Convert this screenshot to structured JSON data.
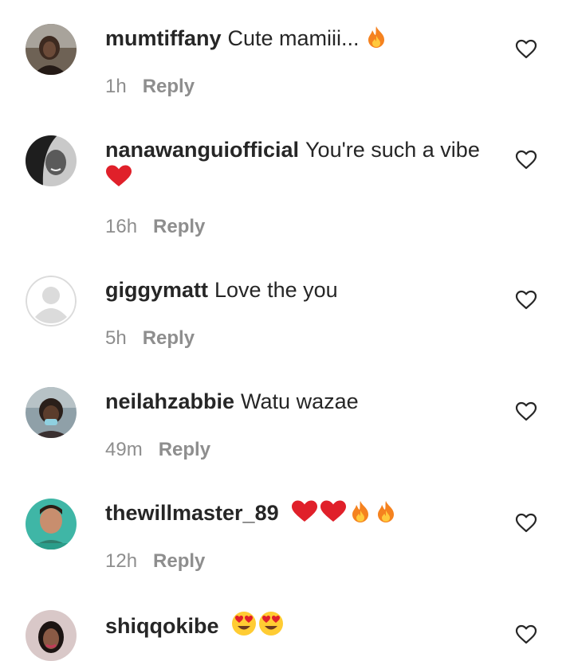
{
  "comments": [
    {
      "username": "mumtiffany",
      "text": "Cute mamiii...",
      "time": "1h",
      "reply_label": "Reply",
      "avatar_icon": "user-photo-avatar"
    },
    {
      "username": "nanawanguiofficial",
      "text": "You're such a vibe",
      "time": "16h",
      "reply_label": "Reply",
      "avatar_icon": "user-photo-avatar"
    },
    {
      "username": "giggymatt",
      "text": "Love the you",
      "time": "5h",
      "reply_label": "Reply",
      "avatar_icon": "default-profile-avatar"
    },
    {
      "username": "neilahzabbie",
      "text": "Watu wazae",
      "time": "49m",
      "reply_label": "Reply",
      "avatar_icon": "user-photo-avatar"
    },
    {
      "username": "thewillmaster_89",
      "text": "",
      "time": "12h",
      "reply_label": "Reply",
      "avatar_icon": "user-photo-avatar"
    },
    {
      "username": "shiqqokibe",
      "text": "",
      "time": "",
      "reply_label": "",
      "avatar_icon": "user-photo-avatar"
    }
  ],
  "colors": {
    "text": "#262626",
    "meta": "#8e8e8e",
    "heart_red": "#e0202a",
    "fire_orange": "#f5821f"
  },
  "icons": {
    "like": "heart-outline-icon",
    "fire": "fire-emoji",
    "heart": "red-heart-emoji",
    "heart_eyes": "heart-eyes-emoji"
  }
}
